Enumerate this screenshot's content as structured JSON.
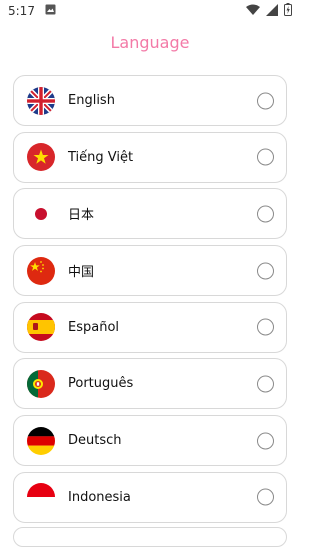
{
  "status": {
    "time": "5:17"
  },
  "title": "Language",
  "languages": [
    {
      "label": "English",
      "flag": "uk-flag-icon"
    },
    {
      "label": "Tiếng Việt",
      "flag": "vietnam-flag-icon"
    },
    {
      "label": "日本",
      "flag": "japan-flag-icon"
    },
    {
      "label": "中国",
      "flag": "china-flag-icon"
    },
    {
      "label": "Español",
      "flag": "spain-flag-icon"
    },
    {
      "label": "Português",
      "flag": "portugal-flag-icon"
    },
    {
      "label": "Deutsch",
      "flag": "germany-flag-icon"
    },
    {
      "label": "Indonesia",
      "flag": "indonesia-flag-icon"
    }
  ],
  "colors": {
    "accent": "#f37aa7",
    "border": "#d8d8d8"
  }
}
